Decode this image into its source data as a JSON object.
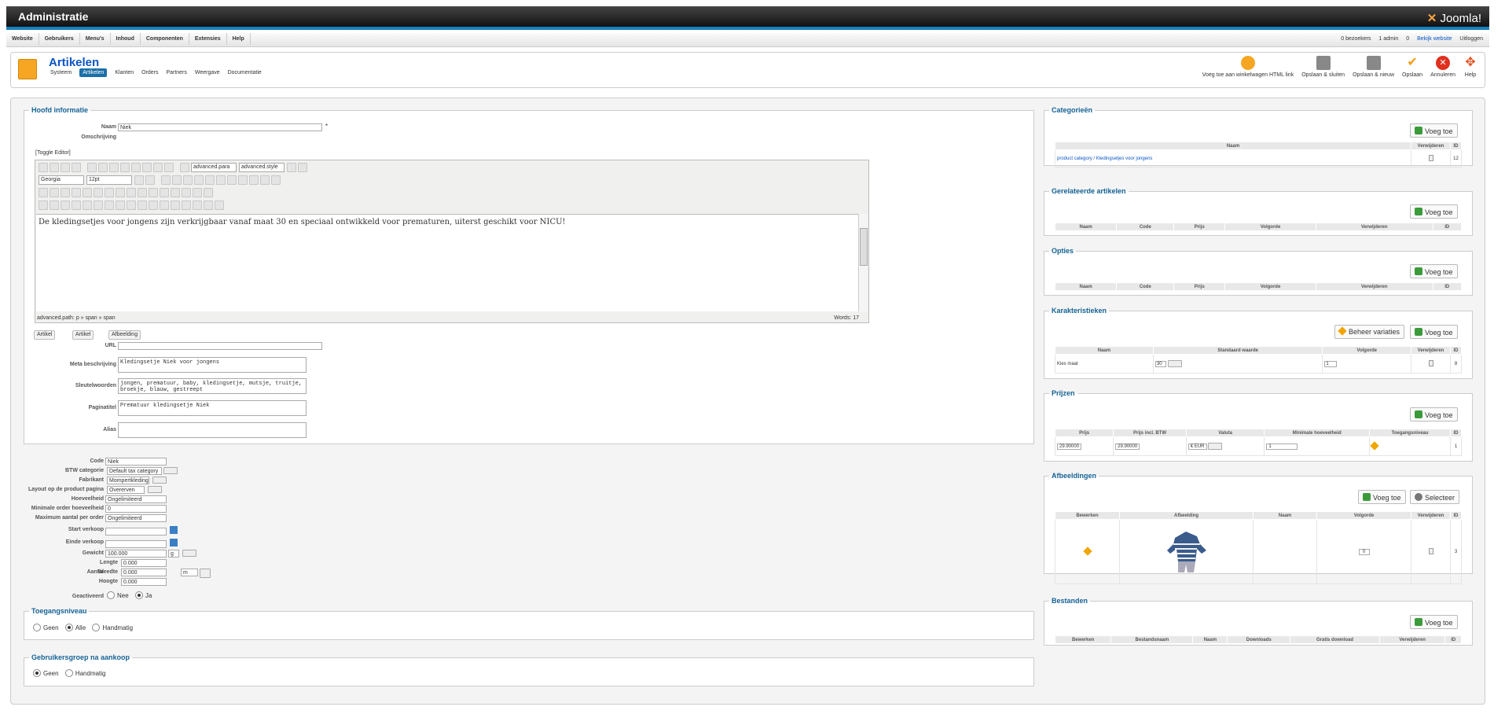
{
  "topbar": {
    "title": "Administratie",
    "brand": "Joomla!"
  },
  "menubar": {
    "items": [
      "Website",
      "Gebruikers",
      "Menu's",
      "Inhoud",
      "Componenten",
      "Extensies",
      "Help"
    ],
    "status": {
      "visitors": "0 bezoekers",
      "admins": "1 admin",
      "messages": "0",
      "view_site": "Bekijk website",
      "logout": "Uitloggen"
    }
  },
  "page": {
    "title": "Artikelen",
    "submenu": [
      "Systeem",
      "Artikelen",
      "Klanten",
      "Orders",
      "Partners",
      "Weergave",
      "Documentatie"
    ],
    "toolbar": [
      "Voeg toe aan winkelwagen HTML link",
      "Opslaan & sluiten",
      "Opslaan & nieuw",
      "Opslaan",
      "Annuleren",
      "Help"
    ]
  },
  "main_info": {
    "legend": "Hoofd informatie",
    "name_label": "Naam",
    "name_value": "Niek",
    "required_mark": "*",
    "desc_label": "Omschrijving",
    "toggle_editor": "[Toggle Editor]",
    "editor": {
      "font": "Georgia",
      "size": "12pt",
      "para": "advanced.para",
      "style": "advanced.style",
      "content": "De kledingsetjes voor jongens zijn verkrijgbaar vanaf maat 30 en speciaal ontwikkeld voor prematuren, uiterst geschikt voor NICU!",
      "path": "advanced.path: p » span » span",
      "words": "Words: 17"
    },
    "tabs": [
      "Artikel",
      "Artikel",
      "Afbeelding"
    ],
    "url_label": "URL",
    "meta_label": "Meta beschrijving",
    "meta_value": "Kledingsetje Niek voor jongens",
    "keywords_label": "Sleutelwoorden",
    "keywords_value": "jongen, prematuur, baby, kledingsetje, mutsje, truitje, broekje, blauw, gestreept",
    "pagetitle_label": "Paginatitel",
    "pagetitle_value": "Prematuur kledingsetje Niek",
    "alias_label": "Alias"
  },
  "details": {
    "code_label": "Code",
    "code": "Niek",
    "btw_label": "BTW categorie",
    "btw": "Default tax category",
    "fab_label": "Fabrikant",
    "fab": "Mompertkleding",
    "layout_label": "Layout op de product pagina",
    "layout": "Overerven",
    "hoev_label": "Hoeveelheid",
    "hoev": "Ongelimiteerd",
    "minorder_label": "Minimale order hoeveelheid",
    "minorder": "0",
    "maxorder_label": "Maximum aantal per order",
    "maxorder": "Ongelimiteerd",
    "start_label": "Start verkoop",
    "end_label": "Einde verkoop",
    "weight_label": "Gewicht",
    "weight": "100.000",
    "weight_unit": "g",
    "aantal_label": "Aantal",
    "lengte_label": "Lengte",
    "lengte": "0.000",
    "breedte_label": "Breedte",
    "breedte": "0.000",
    "hoogte_label": "Hoogte",
    "hoogte": "0.000",
    "dim_unit": "m",
    "active_label": "Geactiveerd",
    "no": "Nee",
    "yes": "Ja"
  },
  "access": {
    "legend": "Toegangsniveau",
    "opts": [
      "Geen",
      "Alle",
      "Handmatig"
    ]
  },
  "usergroup": {
    "legend": "Gebruikersgroep na aankoop",
    "opts": [
      "Geen",
      "Handmatig"
    ]
  },
  "right": {
    "add": "Voeg toe",
    "categories": {
      "legend": "Categorieën",
      "cols": [
        "Naam",
        "Verwijderen",
        "ID"
      ],
      "row": [
        "product category / Kledingsetjes voor jongens",
        "12"
      ]
    },
    "related": {
      "legend": "Gerelateerde artikelen",
      "cols": [
        "Naam",
        "Code",
        "Prijs",
        "Volgorde",
        "Verwijderen",
        "ID"
      ]
    },
    "options": {
      "legend": "Opties",
      "cols": [
        "Naam",
        "Code",
        "Prijs",
        "Volgorde",
        "Verwijderen",
        "ID"
      ]
    },
    "chars": {
      "legend": "Karakteristieken",
      "manage": "Beheer variaties",
      "cols": [
        "Naam",
        "Standaard waarde",
        "Volgorde",
        "Verwijderen",
        "ID"
      ],
      "row": [
        "Kies maat",
        "30",
        "1",
        "8"
      ]
    },
    "prices": {
      "legend": "Prijzen",
      "cols": [
        "Prijs",
        "Prijs incl. BTW",
        "Valuta",
        "Minimale hoeveelheid",
        "Toegangsniveau",
        "ID"
      ],
      "row": [
        "29.90000",
        "29.90000",
        "€ EUR",
        "1",
        "1"
      ]
    },
    "images": {
      "legend": "Afbeeldingen",
      "select": "Selecteer",
      "cols": [
        "Bewerken",
        "Afbeelding",
        "Naam",
        "Volgorde",
        "Verwijderen",
        "ID"
      ],
      "row": [
        "0",
        "3"
      ]
    },
    "files": {
      "legend": "Bestanden",
      "cols": [
        "Bewerken",
        "Bestandsnaam",
        "Naam",
        "Downloads",
        "Gratis download",
        "Verwijderen",
        "ID"
      ]
    }
  }
}
